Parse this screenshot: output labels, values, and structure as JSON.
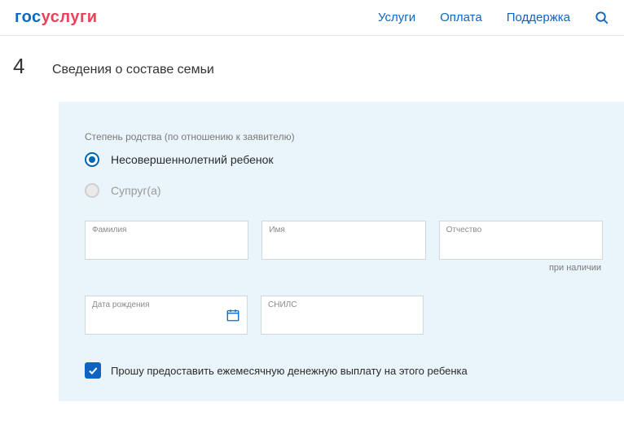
{
  "header": {
    "logo": {
      "part1": "гос",
      "part2": "услуги"
    },
    "nav": {
      "services": "Услуги",
      "payment": "Оплата",
      "support": "Поддержка"
    }
  },
  "step": {
    "number": "4",
    "title": "Сведения о составе семьи"
  },
  "panel": {
    "relationship_label": "Степень родства (по отношению к заявителю)",
    "options": {
      "child": "Несовершеннолетний ребенок",
      "spouse": "Супруг(а)"
    },
    "fields": {
      "surname": "Фамилия",
      "name": "Имя",
      "patronymic": "Отчество",
      "patronymic_note": "при наличии",
      "dob": "Дата рождения",
      "snils": "СНИЛС"
    },
    "checkbox": {
      "label": "Прошу предоставить ежемесячную денежную выплату на этого ребенка"
    }
  }
}
